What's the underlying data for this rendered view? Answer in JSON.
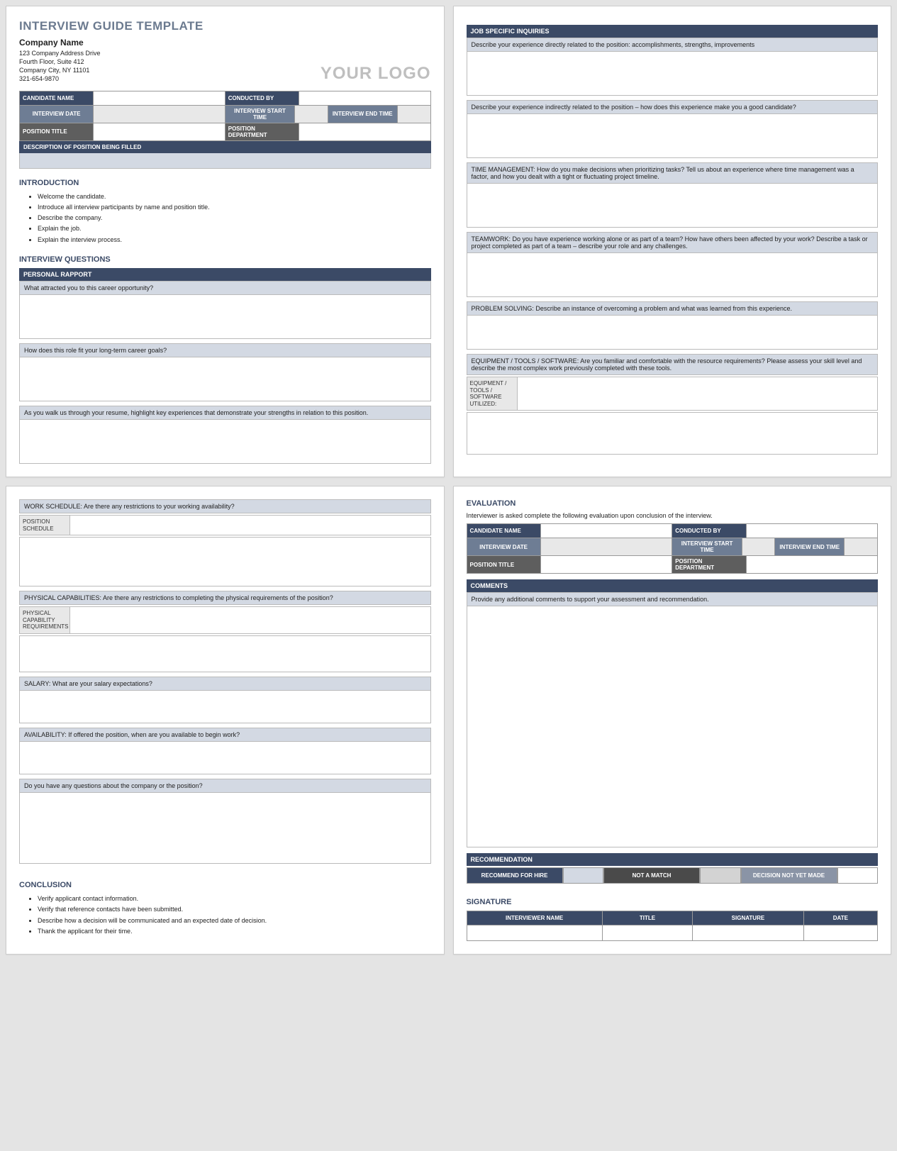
{
  "header": {
    "title": "INTERVIEW GUIDE TEMPLATE",
    "company": "Company Name",
    "addr1": "123 Company Address Drive",
    "addr2": "Fourth Floor, Suite 412",
    "addr3": "Company City, NY 11101",
    "phone": "321-654-9870",
    "logo": "YOUR LOGO"
  },
  "info": {
    "candidate_name": "CANDIDATE NAME",
    "conducted_by": "CONDUCTED BY",
    "interview_date": "INTERVIEW DATE",
    "start_time": "INTERVIEW START TIME",
    "end_time": "INTERVIEW END TIME",
    "position_title": "POSITION TITLE",
    "position_dept": "POSITION DEPARTMENT",
    "desc_label": "DESCRIPTION OF POSITION BEING FILLED"
  },
  "intro": {
    "heading": "INTRODUCTION",
    "items": [
      "Welcome the candidate.",
      "Introduce all interview participants by name and position title.",
      "Describe the company.",
      "Explain the job.",
      "Explain the interview process."
    ]
  },
  "iq": {
    "heading": "INTERVIEW QUESTIONS",
    "rapport": "PERSONAL RAPPORT",
    "q1": "What attracted you to this career opportunity?",
    "q2": "How does this role fit your long-term career goals?",
    "q3": "As you walk us through your resume, highlight key experiences that demonstrate your strengths in relation to this position."
  },
  "job": {
    "bar": "JOB SPECIFIC INQUIRIES",
    "q1": "Describe your experience directly related to the position: accomplishments, strengths, improvements",
    "q2": "Describe your experience indirectly related to the position – how does this experience make you a good candidate?",
    "q3": "TIME MANAGEMENT: How do you make decisions when prioritizing tasks? Tell us about an experience where time management was a factor, and how you dealt with a tight or fluctuating project timeline.",
    "q4": "TEAMWORK: Do you have experience working alone or as part of a team? How have others been affected by your work? Describe a task or project completed as part of a team – describe your role and any challenges.",
    "q5": "PROBLEM SOLVING: Describe an instance of overcoming a problem and what was learned from this experience.",
    "q6": "EQUIPMENT / TOOLS / SOFTWARE: Are you familiar and comfortable with the resource requirements? Please assess your skill level and describe the most complex work previously completed with these tools.",
    "equip_label": "EQUIPMENT / TOOLS / SOFTWARE UTILIZED:"
  },
  "p3": {
    "ws_q": "WORK SCHEDULE: Are there any restrictions to your working availability?",
    "ws_label": "POSITION SCHEDULE",
    "pc_q": "PHYSICAL CAPABILITIES: Are there any restrictions to completing the physical requirements of the position?",
    "pc_label": "PHYSICAL CAPABILITY REQUIREMENTS",
    "sal_q": "SALARY: What are your salary expectations?",
    "avail_q": "AVAILABILITY:  If offered the position, when are you available to begin work?",
    "final_q": "Do you have any questions about the company or the position?",
    "conc_heading": "CONCLUSION",
    "conc_items": [
      "Verify applicant contact information.",
      "Verify that reference contacts have been submitted.",
      "Describe how a decision will be communicated and an expected date of decision.",
      "Thank the applicant for their time."
    ]
  },
  "eval": {
    "heading": "EVALUATION",
    "intro": "Interviewer is asked complete the following evaluation upon conclusion of the interview.",
    "comments_bar": "COMMENTS",
    "comments_prompt": "Provide any additional comments to support your assessment and recommendation.",
    "rec_bar": "RECOMMENDATION",
    "rec1": "RECOMMEND FOR HIRE",
    "rec2": "NOT A MATCH",
    "rec3": "DECISION NOT YET MADE",
    "sig_heading": "SIGNATURE",
    "sig_cols": [
      "INTERVIEWER NAME",
      "TITLE",
      "SIGNATURE",
      "DATE"
    ]
  }
}
